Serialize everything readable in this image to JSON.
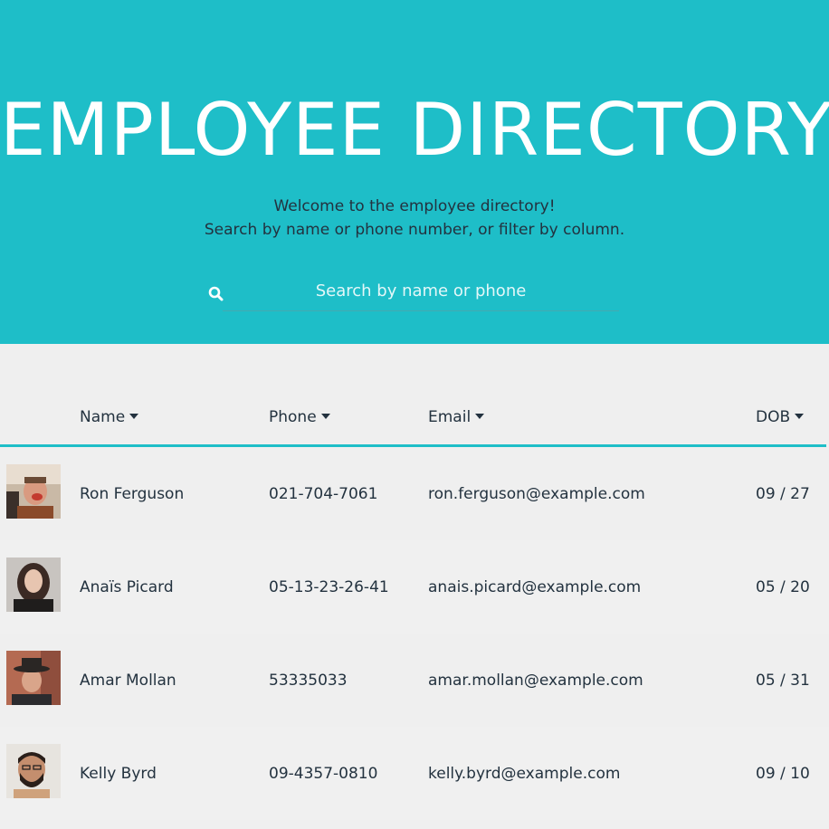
{
  "header": {
    "title": "EMPLOYEE DIRECTORY",
    "subtitle_line1": "Welcome to the employee directory!",
    "subtitle_line2": "Search by name or phone number, or filter by column.",
    "background_color": "#1ebec8"
  },
  "search": {
    "placeholder": "Search by name or phone",
    "value": "",
    "icon": "search-icon"
  },
  "table": {
    "columns": [
      {
        "label": "Name",
        "sort_icon": "caret-down-icon"
      },
      {
        "label": "Phone",
        "sort_icon": "caret-down-icon"
      },
      {
        "label": "Email",
        "sort_icon": "caret-down-icon"
      },
      {
        "label": "DOB",
        "sort_icon": "caret-down-icon"
      }
    ],
    "rows": [
      {
        "avatar": "avatar-photo",
        "name": "Ron Ferguson",
        "phone": "021-704-7061",
        "email": "ron.ferguson@example.com",
        "dob": "09 / 27"
      },
      {
        "avatar": "avatar-photo",
        "name": "Anaïs Picard",
        "phone": "05-13-23-26-41",
        "email": "anais.picard@example.com",
        "dob": "05 / 20"
      },
      {
        "avatar": "avatar-photo",
        "name": "Amar Mollan",
        "phone": "53335033",
        "email": "amar.mollan@example.com",
        "dob": "05 / 31"
      },
      {
        "avatar": "avatar-photo",
        "name": "Kelly Byrd",
        "phone": "09-4357-0810",
        "email": "kelly.byrd@example.com",
        "dob": "09 / 10"
      }
    ]
  }
}
